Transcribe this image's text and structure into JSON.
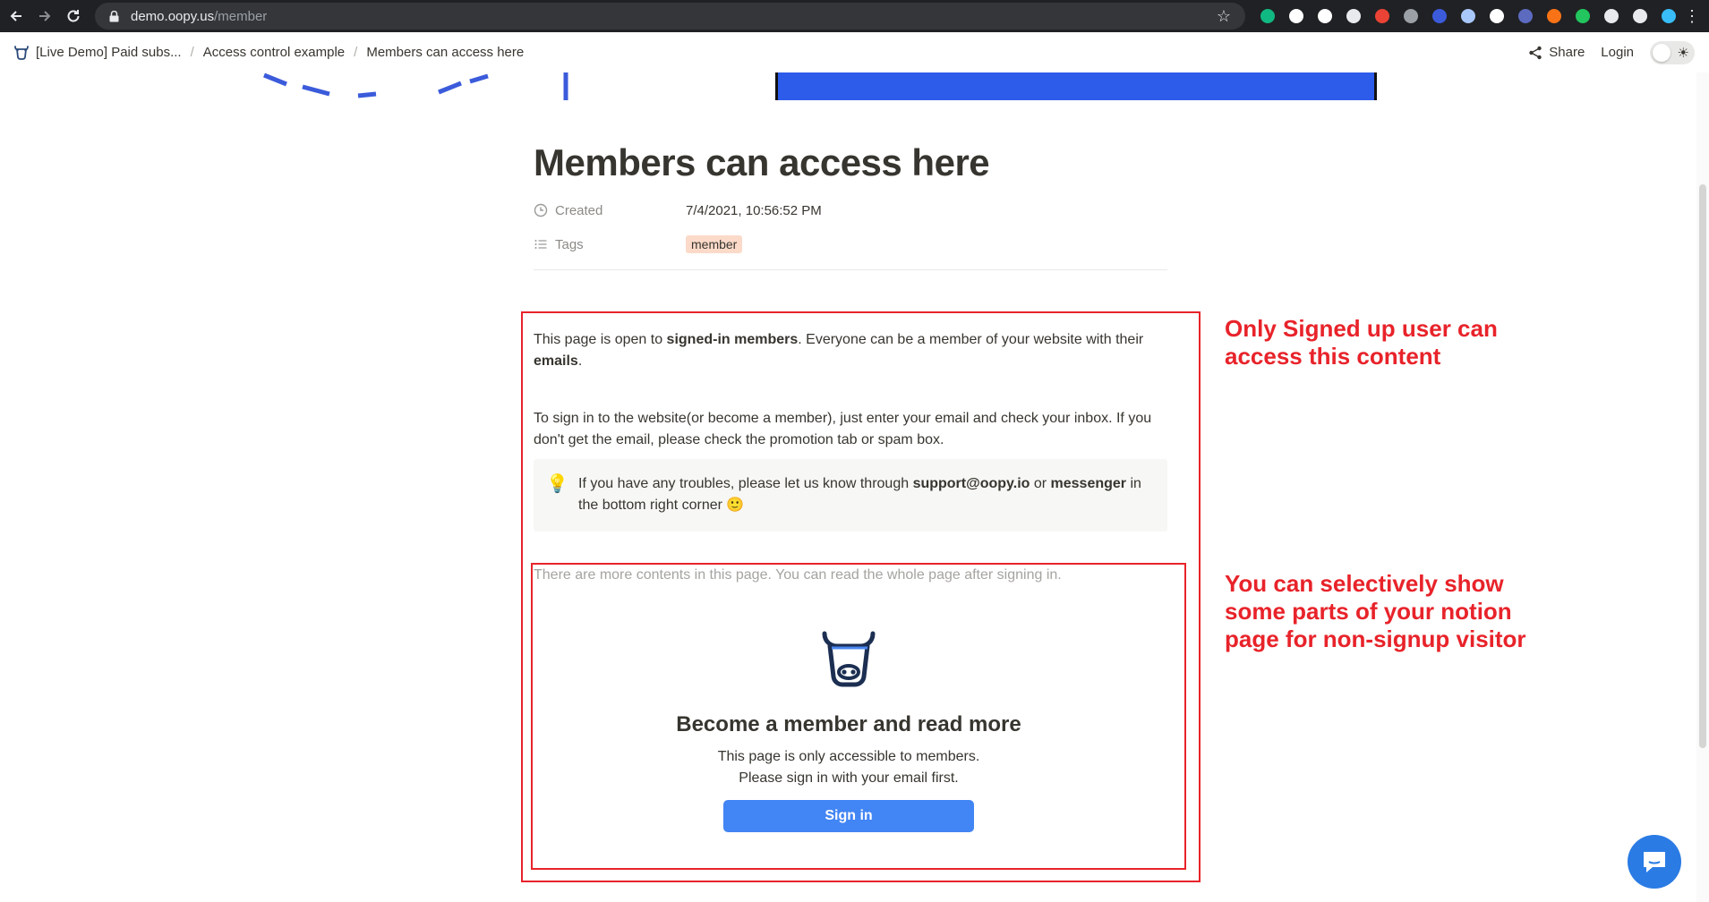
{
  "browser": {
    "url_host": "demo.oopy.us",
    "url_path": "/member",
    "extension_colors": [
      "#10b981",
      "#ffffff",
      "#ffffff",
      "#e8eaed",
      "#ea4335",
      "#9aa0a6",
      "#3b5bdb",
      "#a8c7fa",
      "#ffffff",
      "#5c6bc0",
      "#f97316",
      "#22c55e",
      "#e8eaed",
      "#e8eaed",
      "#38bdf8"
    ]
  },
  "breadcrumb": {
    "items": [
      "[Live Demo] Paid subs...",
      "Access control example",
      "Members can access here"
    ],
    "separator": "/"
  },
  "topbar": {
    "share_label": "Share",
    "login_label": "Login"
  },
  "page": {
    "title": "Members can access here",
    "properties": {
      "created_label": "Created",
      "created_value": "7/4/2021, 10:56:52 PM",
      "tags_label": "Tags",
      "tag_value": "member"
    },
    "para1": {
      "t1": "This page is open to ",
      "b1": "signed-in members",
      "t2": ". Everyone can be a member of your website with their ",
      "b2": "emails",
      "t3": "."
    },
    "para2": "To sign in to the website(or become a member), just enter your email and check your inbox. If you don't get the email, please check the promotion tab or spam box.",
    "callout": {
      "icon": "💡",
      "t1": "If you have any troubles, please let us know through ",
      "b1": "support@oopy.io",
      "t2": " or ",
      "b2": "messenger",
      "t3": " in the bottom right corner ",
      "emoji": "🙂"
    },
    "more_contents": "There are more contents in this page. You can read the whole page after signing in.",
    "member_card": {
      "title": "Become a member and read more",
      "line1": "This page is only accessible to members.",
      "line2": "Please sign in with your email first.",
      "signin_label": "Sign in"
    }
  },
  "annotations": {
    "note1": [
      "Only Signed up user can",
      "access this content"
    ],
    "note2": [
      "You can selectively show",
      "some parts of your notion",
      "page for non-signup visitor"
    ],
    "color": "#e8232a"
  },
  "colors": {
    "accent": "#4285f4",
    "tag_bg": "#fbdac9",
    "chat_bg": "#2a7be4"
  }
}
